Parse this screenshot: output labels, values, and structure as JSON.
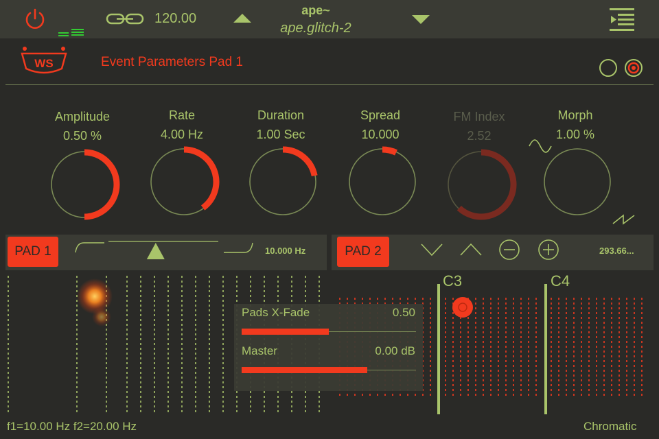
{
  "topbar": {
    "tempo": "120.00",
    "app_name": "ape~",
    "preset_name": "ape.glitch-2"
  },
  "header": {
    "title": "Event Parameters Pad 1",
    "logo_text": "WS"
  },
  "knobs": [
    {
      "label": "Amplitude",
      "value": "0.50 %",
      "fill": 0.5,
      "enabled": true
    },
    {
      "label": "Rate",
      "value": "4.00 Hz",
      "fill": 0.4,
      "enabled": true
    },
    {
      "label": "Duration",
      "value": "1.00 Sec",
      "fill": 0.22,
      "enabled": true
    },
    {
      "label": "Spread",
      "value": "10.000",
      "fill": 0.07,
      "enabled": true
    },
    {
      "label": "FM Index",
      "value": "2.52",
      "fill": 0.62,
      "enabled": false
    },
    {
      "label": "Morph",
      "value": "1.00 %",
      "fill": 0.0,
      "enabled": true
    }
  ],
  "pad1": {
    "label": "PAD 1",
    "freq": "10.000 Hz",
    "slider": 0.43
  },
  "pad2": {
    "label": "PAD 2",
    "freq": "293.66..."
  },
  "mixer": {
    "xfade_label": "Pads X-Fade",
    "xfade_value": "0.50",
    "xfade_level": 0.5,
    "master_label": "Master",
    "master_value": "0.00 dB",
    "master_level": 0.72
  },
  "keyboard": {
    "note1": "C3",
    "note2": "C4",
    "scale": "Chromatic"
  },
  "footer": {
    "freqs": "f1=10.00 Hz f2=20.00 Hz"
  },
  "colors": {
    "accent": "#f23a1e",
    "green": "#a9c46a",
    "bg": "#2a2a27",
    "panel": "#3a3b34"
  }
}
